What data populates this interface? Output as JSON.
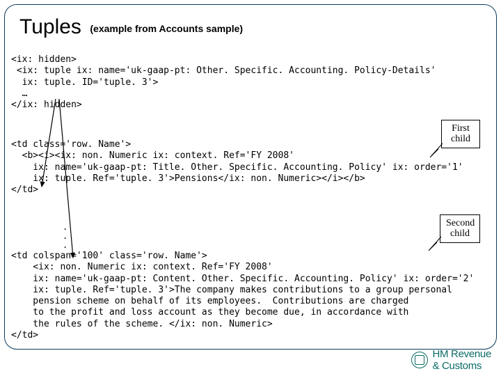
{
  "title": {
    "main": "Tuples",
    "sub": "(example from Accounts sample)"
  },
  "code_block_1": "<ix: hidden>\n <ix: tuple ix: name='uk-gaap-pt: Other. Specific. Accounting. Policy-Details'\n  ix: tuple. ID='tuple. 3'>\n  …\n</ix: hidden>",
  "code_block_2": "<td class='row. Name'>\n  <b><i><ix: non. Numeric ix: context. Ref='FY 2008'\n    ix: name='uk-gaap-pt: Title. Other. Specific. Accounting. Policy' ix: order='1'\n    ix: tuple. Ref='tuple. 3'>Pensions</ix: non. Numeric></i></b>\n</td>",
  "dots": ".\n.\n.",
  "code_block_3": "<td colspan='100' class='row. Name'>\n    <ix: non. Numeric ix: context. Ref='FY 2008'\n    ix: name='uk-gaap-pt: Content. Other. Specific. Accounting. Policy' ix: order='2'\n    ix: tuple. Ref='tuple. 3'>The company makes contributions to a group personal\n    pension scheme on behalf of its employees.  Contributions are charged\n    to the profit and loss account as they become due, in accordance with\n    the rules of the scheme. </ix: non. Numeric>\n</td>",
  "callouts": {
    "first": "First\nchild",
    "second": "Second\nchild"
  },
  "logo": {
    "brand_hm": "HM",
    "brand_rev": "Revenue",
    "brand_cust": "& Customs"
  }
}
